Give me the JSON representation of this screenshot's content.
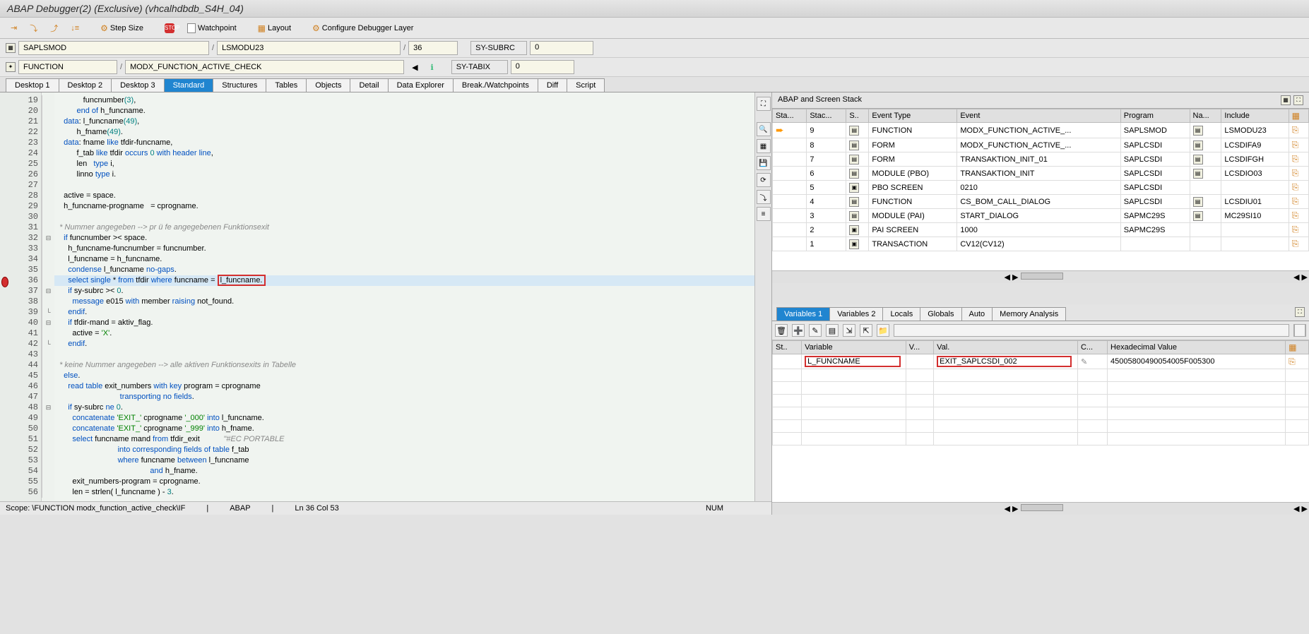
{
  "title": "ABAP Debugger(2)  (Exclusive) (vhcalhdbdb_S4H_04)",
  "toolbar": {
    "step_size": "Step Size",
    "watchpoint": "Watchpoint",
    "layout": "Layout",
    "configure": "Configure Debugger Layer"
  },
  "context": {
    "program": "SAPLSMOD",
    "include": "LSMODU23",
    "line": "36",
    "type": "FUNCTION",
    "name": "MODX_FUNCTION_ACTIVE_CHECK",
    "sy_subrc_label": "SY-SUBRC",
    "sy_subrc_val": "0",
    "sy_tabix_label": "SY-TABIX",
    "sy_tabix_val": "0"
  },
  "tabs": [
    "Desktop 1",
    "Desktop 2",
    "Desktop 3",
    "Standard",
    "Structures",
    "Tables",
    "Objects",
    "Detail",
    "Data Explorer",
    "Break./Watchpoints",
    "Diff",
    "Script"
  ],
  "active_tab": "Standard",
  "code_start_line": 19,
  "scope": {
    "path": "Scope: \\FUNCTION modx_function_active_check\\IF",
    "lang": "ABAP",
    "pos": "Ln  36 Col  53",
    "mode": "NUM"
  },
  "stack_title": "ABAP and Screen Stack",
  "stack_headers": [
    "Sta...",
    "Stac...",
    "S..",
    "Event Type",
    "Event",
    "Program",
    "Na...",
    "Include"
  ],
  "stack": [
    {
      "lvl": "9",
      "type": "FUNCTION",
      "event": "MODX_FUNCTION_ACTIVE_...",
      "prog": "SAPLSMOD",
      "incl": "LSMODU23",
      "current": true
    },
    {
      "lvl": "8",
      "type": "FORM",
      "event": "MODX_FUNCTION_ACTIVE_...",
      "prog": "SAPLCSDI",
      "incl": "LCSDIFA9"
    },
    {
      "lvl": "7",
      "type": "FORM",
      "event": "TRANSAKTION_INIT_01",
      "prog": "SAPLCSDI",
      "incl": "LCSDIFGH"
    },
    {
      "lvl": "6",
      "type": "MODULE (PBO)",
      "event": "TRANSAKTION_INIT",
      "prog": "SAPLCSDI",
      "incl": "LCSDIO03"
    },
    {
      "lvl": "5",
      "type": "PBO SCREEN",
      "event": "0210",
      "prog": "SAPLCSDI",
      "incl": "",
      "screen": true
    },
    {
      "lvl": "4",
      "type": "FUNCTION",
      "event": "CS_BOM_CALL_DIALOG",
      "prog": "SAPLCSDI",
      "incl": "LCSDIU01"
    },
    {
      "lvl": "3",
      "type": "MODULE (PAI)",
      "event": "START_DIALOG",
      "prog": "SAPMC29S",
      "incl": "MC29SI10"
    },
    {
      "lvl": "2",
      "type": "PAI SCREEN",
      "event": "1000",
      "prog": "SAPMC29S",
      "incl": "",
      "screen": true
    },
    {
      "lvl": "1",
      "type": "TRANSACTION",
      "event": "CV12(CV12)",
      "prog": "",
      "incl": "",
      "screen": true
    }
  ],
  "var_tabs": [
    "Variables 1",
    "Variables 2",
    "Locals",
    "Globals",
    "Auto",
    "Memory Analysis"
  ],
  "var_active": "Variables 1",
  "var_headers": [
    "St..",
    "Variable",
    "V...",
    "Val.",
    "C...",
    "Hexadecimal Value"
  ],
  "variables": [
    {
      "name": "L_FUNCNAME",
      "val": "EXIT_SAPLCSDI_002",
      "hex": "45005800490054005F005300"
    }
  ]
}
